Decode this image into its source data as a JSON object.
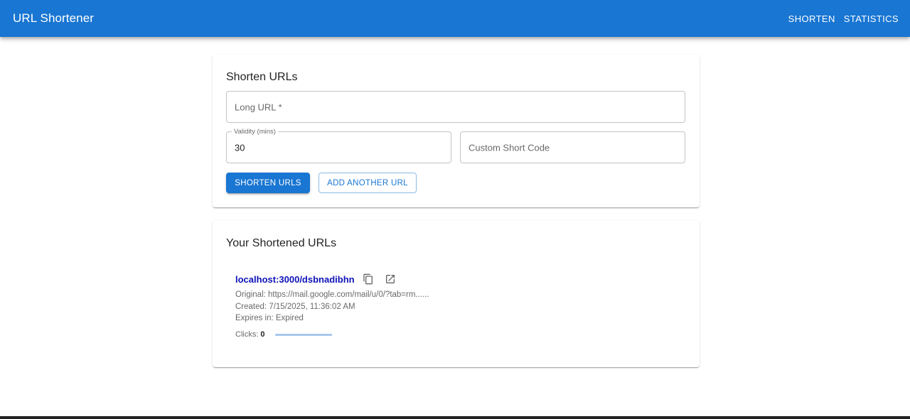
{
  "appbar": {
    "title": "URL Shortener",
    "nav": [
      "SHORTEN",
      "STATISTICS"
    ]
  },
  "form": {
    "title": "Shorten URLs",
    "long_url_placeholder": "Long URL *",
    "validity_label": "Validity (mins)",
    "validity_value": "30",
    "custom_code_placeholder": "Custom Short Code",
    "submit_label": "SHORTEN URLS",
    "add_label": "ADD ANOTHER URL"
  },
  "results": {
    "title": "Your Shortened URLs",
    "items": [
      {
        "short_url": "localhost:3000/dsbnadibhn",
        "original": "Original: https://mail.google.com/mail/u/0/?tab=rm......",
        "created": "Created: 7/15/2025, 11:36:02 AM",
        "expires": "Expires in: Expired",
        "clicks_label": "Clicks:",
        "clicks": "0",
        "clicks_progress": 0
      }
    ]
  },
  "colors": {
    "primary": "#1976d2",
    "link": "#0d11b8"
  },
  "icons": [
    "copy-icon",
    "open-in-new-icon"
  ]
}
